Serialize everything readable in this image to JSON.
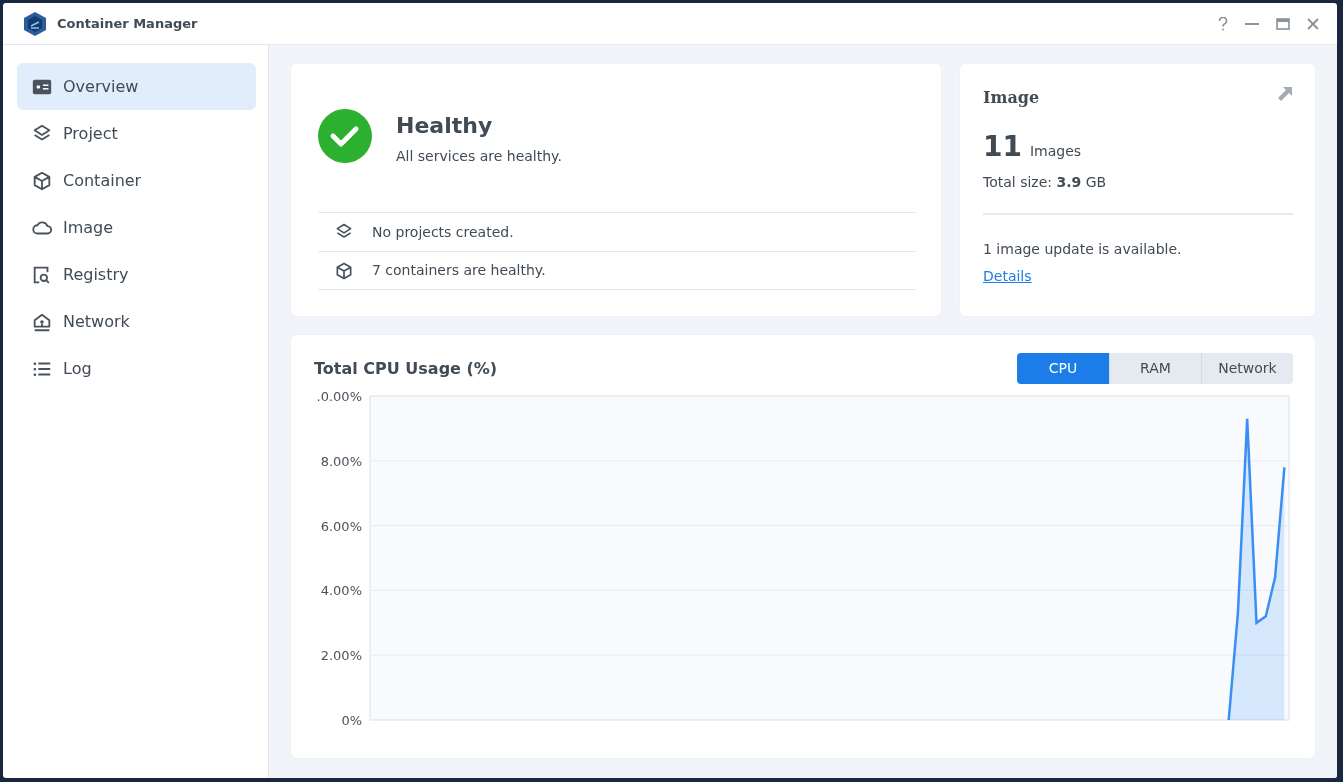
{
  "window": {
    "title": "Container Manager"
  },
  "sidebar": {
    "items": [
      {
        "label": "Overview",
        "selected": true
      },
      {
        "label": "Project",
        "selected": false
      },
      {
        "label": "Container",
        "selected": false
      },
      {
        "label": "Image",
        "selected": false
      },
      {
        "label": "Registry",
        "selected": false
      },
      {
        "label": "Network",
        "selected": false
      },
      {
        "label": "Log",
        "selected": false
      }
    ]
  },
  "status_card": {
    "title": "Healthy",
    "message": "All services are healthy.",
    "items": [
      {
        "text": "No projects created."
      },
      {
        "text": "7 containers are healthy."
      }
    ]
  },
  "image_card": {
    "title": "Image",
    "count": "11",
    "count_label": "Images",
    "size_label": "Total size:",
    "size_value": "3.9",
    "size_unit": "GB",
    "update_text": "1 image update is available.",
    "details_link": "Details"
  },
  "usage_card": {
    "title": "Total CPU Usage (%)",
    "tabs": [
      {
        "label": "CPU",
        "selected": true
      },
      {
        "label": "RAM",
        "selected": false
      },
      {
        "label": "Network",
        "selected": false
      }
    ],
    "chart_data": {
      "type": "area",
      "grid": true,
      "categories": [
        null,
        null,
        null,
        null,
        null,
        null,
        null,
        null,
        null,
        null,
        null,
        null,
        null,
        null,
        null,
        null,
        null,
        null,
        null,
        null,
        null,
        null,
        null,
        null,
        null,
        null,
        null,
        null,
        null,
        null,
        null,
        null,
        null,
        null,
        null,
        null,
        null,
        null,
        null,
        null,
        null,
        null,
        null,
        null,
        null,
        null,
        null,
        null,
        null,
        null,
        null,
        null,
        null,
        null,
        null,
        null,
        null,
        null,
        null,
        null,
        null,
        null,
        null,
        null,
        null,
        null,
        null,
        null,
        null,
        null,
        null,
        null,
        null,
        null,
        null,
        null,
        null,
        null,
        null,
        null,
        null,
        null,
        null,
        null,
        null,
        null,
        null,
        null,
        null,
        null,
        null,
        null,
        null,
        null,
        null,
        null,
        null,
        null,
        null
      ],
      "ylim": [
        0,
        10
      ],
      "yticks": [
        {
          "value": 0,
          "label": "0%"
        },
        {
          "value": 2,
          "label": "2.00%"
        },
        {
          "value": 4,
          "label": "4.00%"
        },
        {
          "value": 6,
          "label": "6.00%"
        },
        {
          "value": 8,
          "label": "8.00%"
        },
        {
          "value": 10,
          "label": ".0.00%"
        }
      ],
      "values": [
        null,
        null,
        null,
        null,
        null,
        null,
        null,
        null,
        null,
        null,
        null,
        null,
        null,
        null,
        null,
        null,
        null,
        null,
        null,
        null,
        null,
        null,
        null,
        null,
        null,
        null,
        null,
        null,
        null,
        null,
        null,
        null,
        null,
        null,
        null,
        null,
        null,
        null,
        null,
        null,
        null,
        null,
        null,
        null,
        null,
        null,
        null,
        null,
        null,
        null,
        null,
        null,
        null,
        null,
        null,
        null,
        null,
        null,
        null,
        null,
        null,
        null,
        null,
        null,
        null,
        null,
        null,
        null,
        null,
        null,
        null,
        null,
        null,
        null,
        null,
        null,
        null,
        null,
        null,
        null,
        null,
        null,
        null,
        null,
        null,
        null,
        null,
        null,
        null,
        null,
        null,
        null,
        0,
        3.3,
        9.3,
        3.0,
        3.2,
        4.4,
        7.8
      ]
    }
  }
}
